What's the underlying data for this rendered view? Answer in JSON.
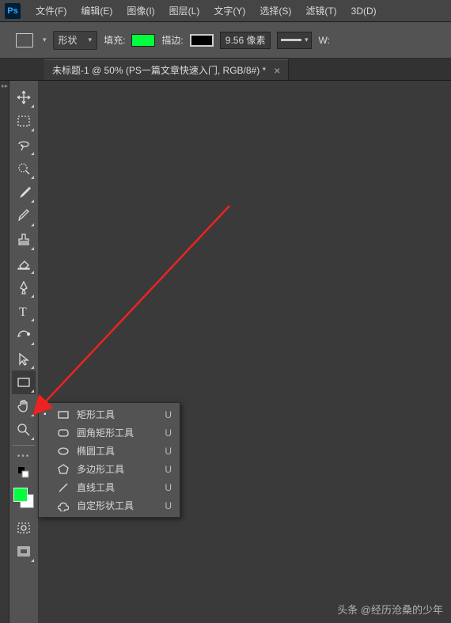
{
  "menu": {
    "items": [
      "文件(F)",
      "编辑(E)",
      "图像(I)",
      "图层(L)",
      "文字(Y)",
      "选择(S)",
      "滤镜(T)",
      "3D(D)"
    ]
  },
  "options": {
    "mode_label": "形状",
    "fill_label": "填充:",
    "stroke_label": "描边:",
    "stroke_value": "9.56 像素",
    "width_label": "W:"
  },
  "tab": {
    "title": "未标题-1 @ 50% (PS一篇文章快速入门, RGB/8#) *"
  },
  "flyout": {
    "items": [
      {
        "label": "矩形工具",
        "shortcut": "U",
        "icon": "rect",
        "selected": true
      },
      {
        "label": "圆角矩形工具",
        "shortcut": "U",
        "icon": "roundrect",
        "selected": false
      },
      {
        "label": "椭圆工具",
        "shortcut": "U",
        "icon": "ellipse",
        "selected": false
      },
      {
        "label": "多边形工具",
        "shortcut": "U",
        "icon": "polygon",
        "selected": false
      },
      {
        "label": "直线工具",
        "shortcut": "U",
        "icon": "line",
        "selected": false
      },
      {
        "label": "自定形状工具",
        "shortcut": "U",
        "icon": "custom",
        "selected": false
      }
    ]
  },
  "watermark": "头条 @经历沧桑的少年",
  "colors": {
    "accent": "#00ff3c"
  }
}
